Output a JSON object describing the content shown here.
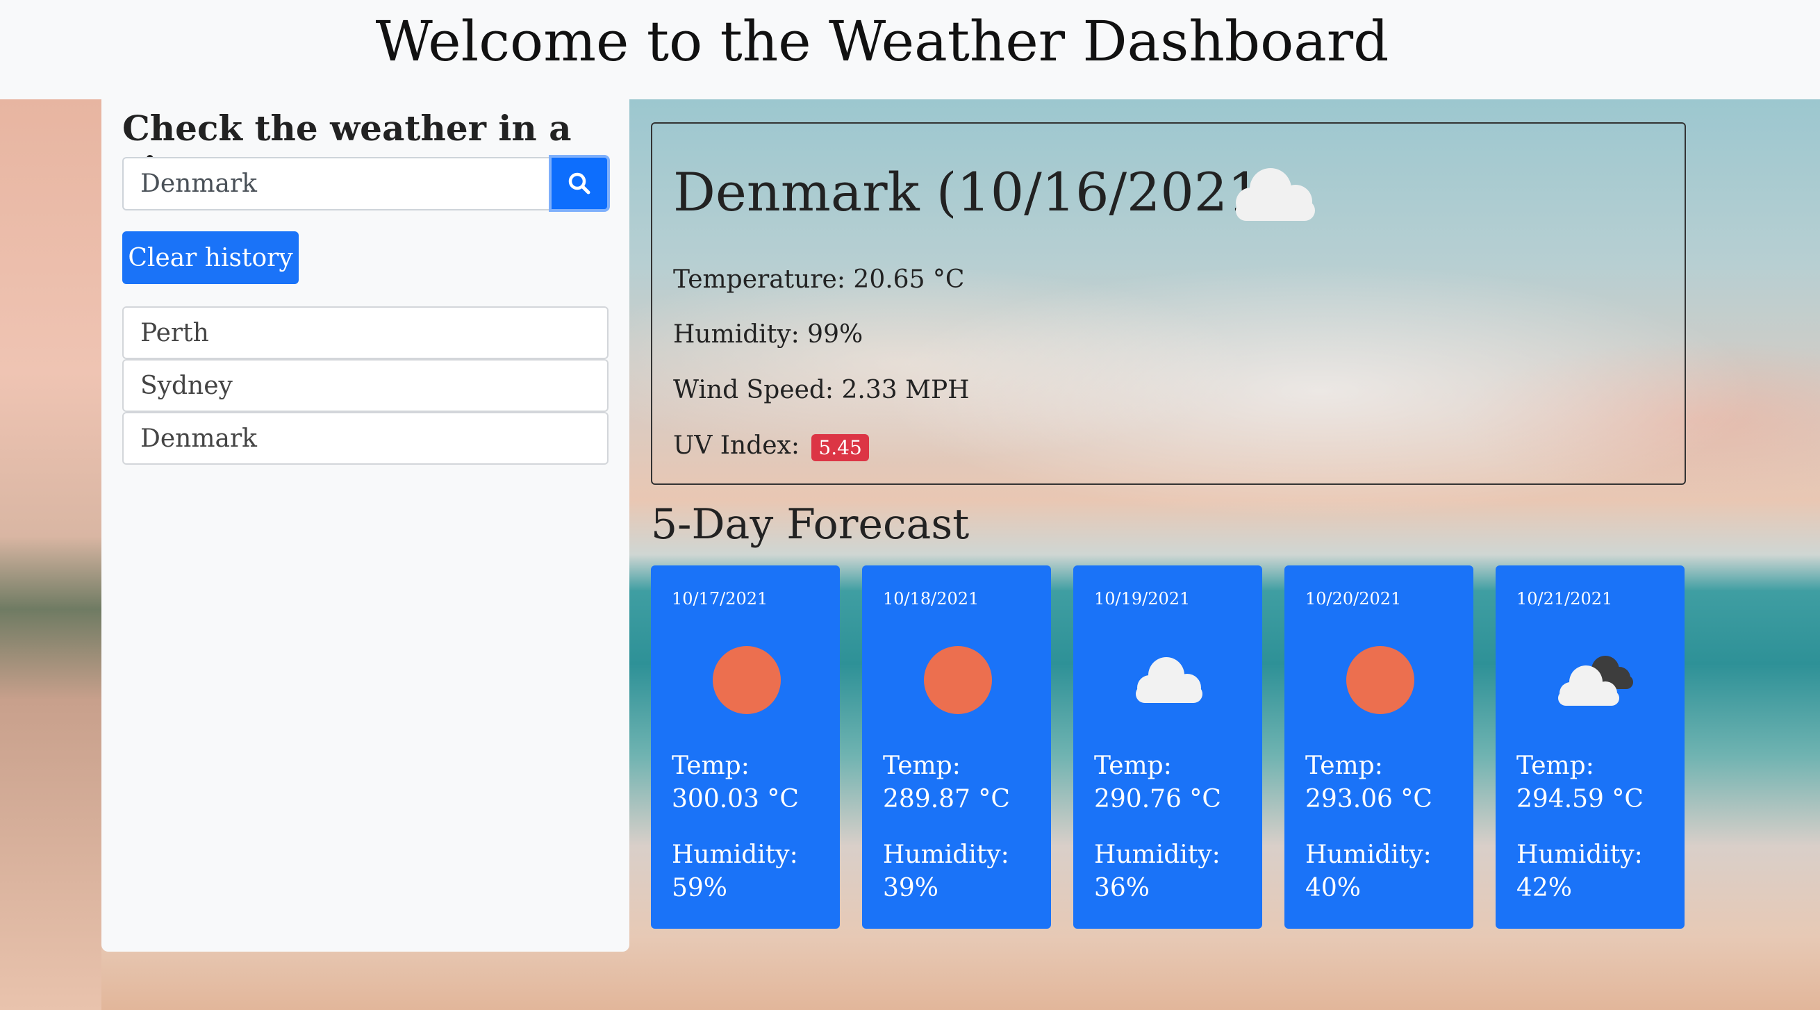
{
  "header": {
    "title": "Welcome to the Weather Dashboard"
  },
  "sidebar": {
    "heading": "Check the weather in a city",
    "search": {
      "value": "Denmark",
      "placeholder": ""
    },
    "search_button_icon": "search-icon",
    "clear_button_label": "Clear history",
    "history": [
      "Perth",
      "Sydney",
      "Denmark"
    ]
  },
  "current": {
    "city_date": "Denmark (10/16/2021)",
    "icon": "cloud-icon",
    "temperature": "Temperature: 20.65 °C",
    "humidity": "Humidity: 99%",
    "wind": "Wind Speed: 2.33 MPH",
    "uv_label": "UV Index:",
    "uv_value": "5.45",
    "uv_color": "#dc3545"
  },
  "forecast": {
    "title": "5-Day Forecast",
    "card_color": "#1a73f8",
    "days": [
      {
        "date": "10/17/2021",
        "icon": "sun-icon",
        "temp_label": "Temp:",
        "temp": "300.03 °C",
        "hum_label": "Humidity:",
        "hum": "59%"
      },
      {
        "date": "10/18/2021",
        "icon": "sun-icon",
        "temp_label": "Temp:",
        "temp": "289.87 °C",
        "hum_label": "Humidity:",
        "hum": "39%"
      },
      {
        "date": "10/19/2021",
        "icon": "cloud-icon",
        "temp_label": "Temp:",
        "temp": "290.76 °C",
        "hum_label": "Humidity:",
        "hum": "36%"
      },
      {
        "date": "10/20/2021",
        "icon": "sun-icon",
        "temp_label": "Temp:",
        "temp": "293.06 °C",
        "hum_label": "Humidity:",
        "hum": "40%"
      },
      {
        "date": "10/21/2021",
        "icon": "dark-clouds-icon",
        "temp_label": "Temp:",
        "temp": "294.59 °C",
        "hum_label": "Humidity:",
        "hum": "42%"
      }
    ]
  }
}
